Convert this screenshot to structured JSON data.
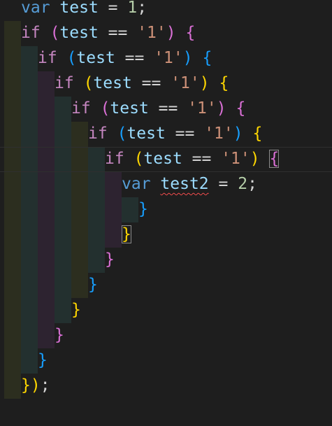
{
  "editor": {
    "colors": {
      "background": "#1e1e1e",
      "keyword": "#569cd6",
      "control": "#c586c0",
      "variable": "#9cdcfe",
      "string": "#ce9178",
      "number": "#b5cea8",
      "bracket_gold": "#ffd700",
      "bracket_pink": "#da70d6",
      "bracket_blue": "#179fff",
      "guide_olive": "#2c2e1f",
      "guide_teal": "#23302f",
      "guide_plum": "#2d2330",
      "error_squiggle": "#f14c4c"
    },
    "lines": [
      [
        {
          "t": "var",
          "c": "kw"
        },
        {
          "t": " ",
          "c": "sp"
        },
        {
          "t": "test",
          "c": "var"
        },
        {
          "t": " = ",
          "c": "op"
        },
        {
          "t": "1",
          "c": "num"
        },
        {
          "t": ";",
          "c": "punct"
        }
      ],
      [
        {
          "t": "if",
          "c": "ctl"
        },
        {
          "t": " ",
          "c": "sp"
        },
        {
          "t": "(",
          "c": "b2"
        },
        {
          "t": "test",
          "c": "var"
        },
        {
          "t": " == ",
          "c": "op"
        },
        {
          "t": "'1'",
          "c": "str"
        },
        {
          "t": ")",
          "c": "b2"
        },
        {
          "t": " ",
          "c": "sp"
        },
        {
          "t": "{",
          "c": "b2"
        }
      ],
      [
        {
          "t": "if",
          "c": "ctl"
        },
        {
          "t": " ",
          "c": "sp"
        },
        {
          "t": "(",
          "c": "b3"
        },
        {
          "t": "test",
          "c": "var"
        },
        {
          "t": " == ",
          "c": "op"
        },
        {
          "t": "'1'",
          "c": "str"
        },
        {
          "t": ")",
          "c": "b3"
        },
        {
          "t": " ",
          "c": "sp"
        },
        {
          "t": "{",
          "c": "b3"
        }
      ],
      [
        {
          "t": "if",
          "c": "ctl"
        },
        {
          "t": " ",
          "c": "sp"
        },
        {
          "t": "(",
          "c": "b1"
        },
        {
          "t": "test",
          "c": "var"
        },
        {
          "t": " == ",
          "c": "op"
        },
        {
          "t": "'1'",
          "c": "str"
        },
        {
          "t": ")",
          "c": "b1"
        },
        {
          "t": " ",
          "c": "sp"
        },
        {
          "t": "{",
          "c": "b1"
        }
      ],
      [
        {
          "t": "if",
          "c": "ctl"
        },
        {
          "t": " ",
          "c": "sp"
        },
        {
          "t": "(",
          "c": "b2"
        },
        {
          "t": "test",
          "c": "var"
        },
        {
          "t": " == ",
          "c": "op"
        },
        {
          "t": "'1'",
          "c": "str"
        },
        {
          "t": ")",
          "c": "b2"
        },
        {
          "t": " ",
          "c": "sp"
        },
        {
          "t": "{",
          "c": "b2"
        }
      ],
      [
        {
          "t": "if",
          "c": "ctl"
        },
        {
          "t": " ",
          "c": "sp"
        },
        {
          "t": "(",
          "c": "b3"
        },
        {
          "t": "test",
          "c": "var"
        },
        {
          "t": " == ",
          "c": "op"
        },
        {
          "t": "'1'",
          "c": "str"
        },
        {
          "t": ")",
          "c": "b3"
        },
        {
          "t": " ",
          "c": "sp"
        },
        {
          "t": "{",
          "c": "b1"
        }
      ],
      [
        {
          "t": "if",
          "c": "ctl"
        },
        {
          "t": " ",
          "c": "sp"
        },
        {
          "t": "(",
          "c": "b1"
        },
        {
          "t": "test",
          "c": "var"
        },
        {
          "t": " == ",
          "c": "op"
        },
        {
          "t": "'1'",
          "c": "str"
        },
        {
          "t": ")",
          "c": "b1"
        },
        {
          "t": " ",
          "c": "sp"
        },
        {
          "t": "{",
          "c": "b2"
        }
      ],
      [
        {
          "t": "var",
          "c": "kw"
        },
        {
          "t": " ",
          "c": "sp"
        },
        {
          "t": "test2",
          "c": "var-err"
        },
        {
          "t": " = ",
          "c": "op"
        },
        {
          "t": "2",
          "c": "num"
        },
        {
          "t": ";",
          "c": "punct"
        }
      ],
      [
        {
          "t": "}",
          "c": "b3"
        }
      ],
      [
        {
          "t": "}",
          "c": "b1"
        }
      ],
      [
        {
          "t": "}",
          "c": "b2"
        }
      ],
      [
        {
          "t": "}",
          "c": "b3"
        }
      ],
      [
        {
          "t": "}",
          "c": "b1"
        }
      ],
      [
        {
          "t": "}",
          "c": "b2"
        }
      ],
      [
        {
          "t": "}",
          "c": "b3"
        }
      ],
      [
        {
          "t": "})",
          "c": "b1"
        },
        {
          "t": ";",
          "c": "punct"
        }
      ]
    ],
    "cursor_line": 6
  }
}
